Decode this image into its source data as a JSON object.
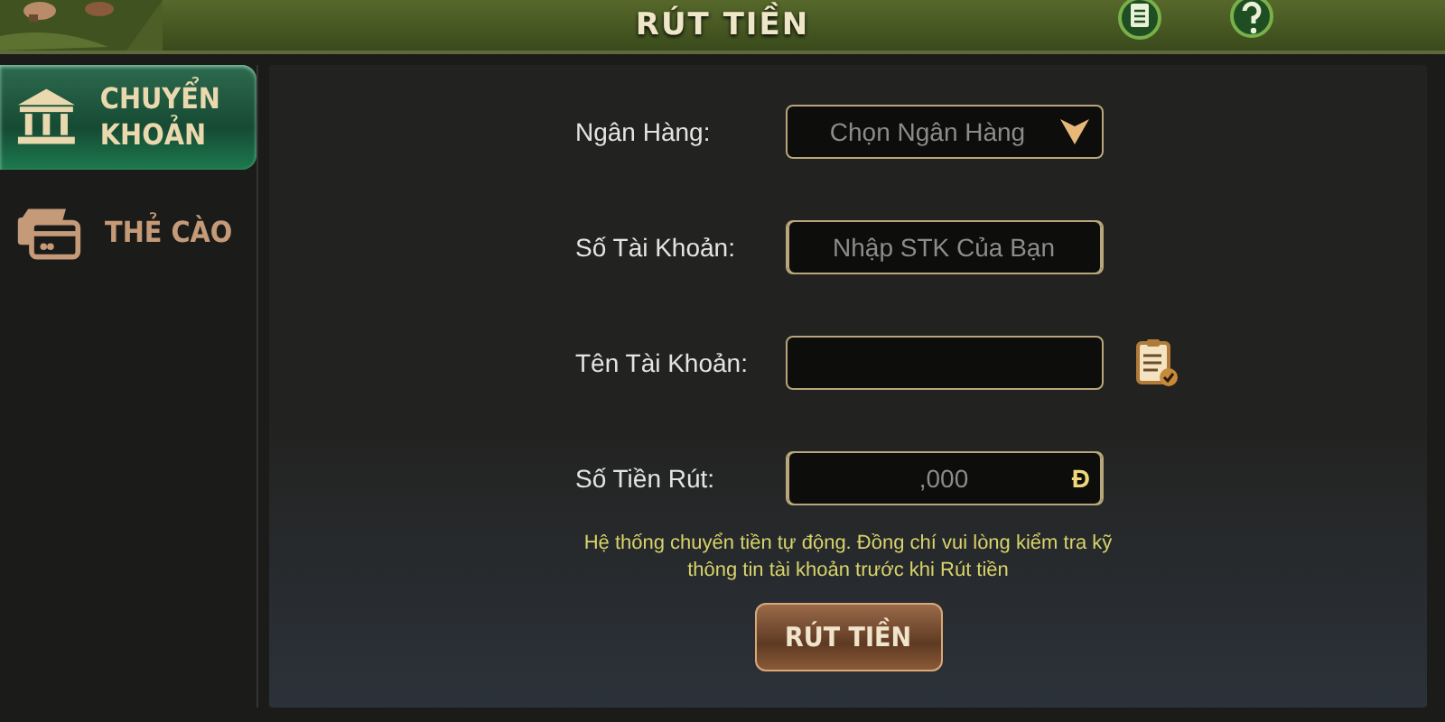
{
  "header": {
    "title": "RÚT TIỀN"
  },
  "sidebar": {
    "items": [
      {
        "label": "CHUYỂN KHOẢN",
        "kind": "bank",
        "selected": true
      },
      {
        "label": "THẺ CÀO",
        "kind": "card",
        "selected": false
      }
    ]
  },
  "form": {
    "rows": [
      {
        "label": "Ngân Hàng:",
        "kind": "select",
        "placeholder": "Chọn Ngân Hàng"
      },
      {
        "label": "Số Tài Khoản:",
        "kind": "input",
        "placeholder": "Nhập STK Của Bạn"
      },
      {
        "label": "Tên Tài Khoản:",
        "kind": "readonly"
      },
      {
        "label": "Số Tiền Rút:",
        "kind": "amount",
        "placeholder": ",000",
        "unit": "Đ"
      }
    ],
    "note": "Hệ thống chuyển tiền tự động. Đồng chí vui lòng kiểm tra kỹ thông tin tài khoản trước khi Rút tiền",
    "submit": "RÚT TIỀN"
  }
}
